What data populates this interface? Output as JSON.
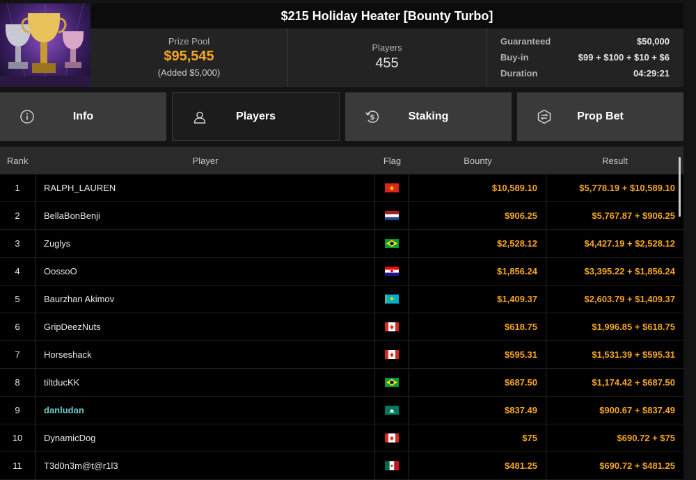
{
  "tournament": {
    "title": "$215 Holiday Heater [Bounty Turbo]",
    "prize_pool_label": "Prize Pool",
    "prize_pool_value": "$95,545",
    "prize_pool_added": "(Added $5,000)",
    "players_label": "Players",
    "players_value": "455",
    "details": [
      {
        "label": "Guaranteed",
        "value": "$50,000"
      },
      {
        "label": "Buy-in",
        "value": "$99 + $100 + $10 + $6"
      },
      {
        "label": "Duration",
        "value": "04:29:21"
      }
    ]
  },
  "tabs": [
    {
      "label": "Info",
      "icon": "info-icon",
      "active": false
    },
    {
      "label": "Players",
      "icon": "user-icon",
      "active": true
    },
    {
      "label": "Staking",
      "icon": "dollar-coin-icon",
      "active": false
    },
    {
      "label": "Prop Bet",
      "icon": "prop-bet-icon",
      "active": false
    }
  ],
  "table": {
    "headers": {
      "rank": "Rank",
      "player": "Player",
      "flag": "Flag",
      "bounty": "Bounty",
      "result": "Result"
    },
    "rows": [
      {
        "rank": "1",
        "player": "RALPH_LAUREN",
        "flag": "vietnam-flag",
        "bounty": "$10,589.10",
        "result": "$5,778.19 + $10,589.10"
      },
      {
        "rank": "2",
        "player": "BellaBonBenji",
        "flag": "netherlands-flag",
        "bounty": "$906.25",
        "result": "$5,767.87 + $906.25"
      },
      {
        "rank": "3",
        "player": "Zuglys",
        "flag": "brazil-flag",
        "bounty": "$2,528.12",
        "result": "$4,427.19 + $2,528.12"
      },
      {
        "rank": "4",
        "player": "OossoO",
        "flag": "croatia-flag",
        "bounty": "$1,856.24",
        "result": "$3,395.22 + $1,856.24"
      },
      {
        "rank": "5",
        "player": "Baurzhan Akimov",
        "flag": "kazakhstan-flag",
        "bounty": "$1,409.37",
        "result": "$2,603.79 + $1,409.37"
      },
      {
        "rank": "6",
        "player": "GripDeezNuts",
        "flag": "canada-flag",
        "bounty": "$618.75",
        "result": "$1,996.85 + $618.75"
      },
      {
        "rank": "7",
        "player": "Horseshack",
        "flag": "canada-flag",
        "bounty": "$595.31",
        "result": "$1,531.39 + $595.31"
      },
      {
        "rank": "8",
        "player": "tiltducKK",
        "flag": "brazil-flag",
        "bounty": "$687.50",
        "result": "$1,174.42 + $687.50"
      },
      {
        "rank": "9",
        "player": "danludan",
        "flag": "macau-flag",
        "bounty": "$837.49",
        "result": "$900.67 + $837.49",
        "highlight": true
      },
      {
        "rank": "10",
        "player": "DynamicDog",
        "flag": "canada-flag",
        "bounty": "$75",
        "result": "$690.72 + $75"
      },
      {
        "rank": "11",
        "player": "T3d0n3m@t@r1l3",
        "flag": "mexico-flag",
        "bounty": "$481.25",
        "result": "$690.72 + $481.25"
      }
    ]
  },
  "colors": {
    "accent_gold": "#f5a623",
    "highlight_teal": "#6fc7c7"
  }
}
